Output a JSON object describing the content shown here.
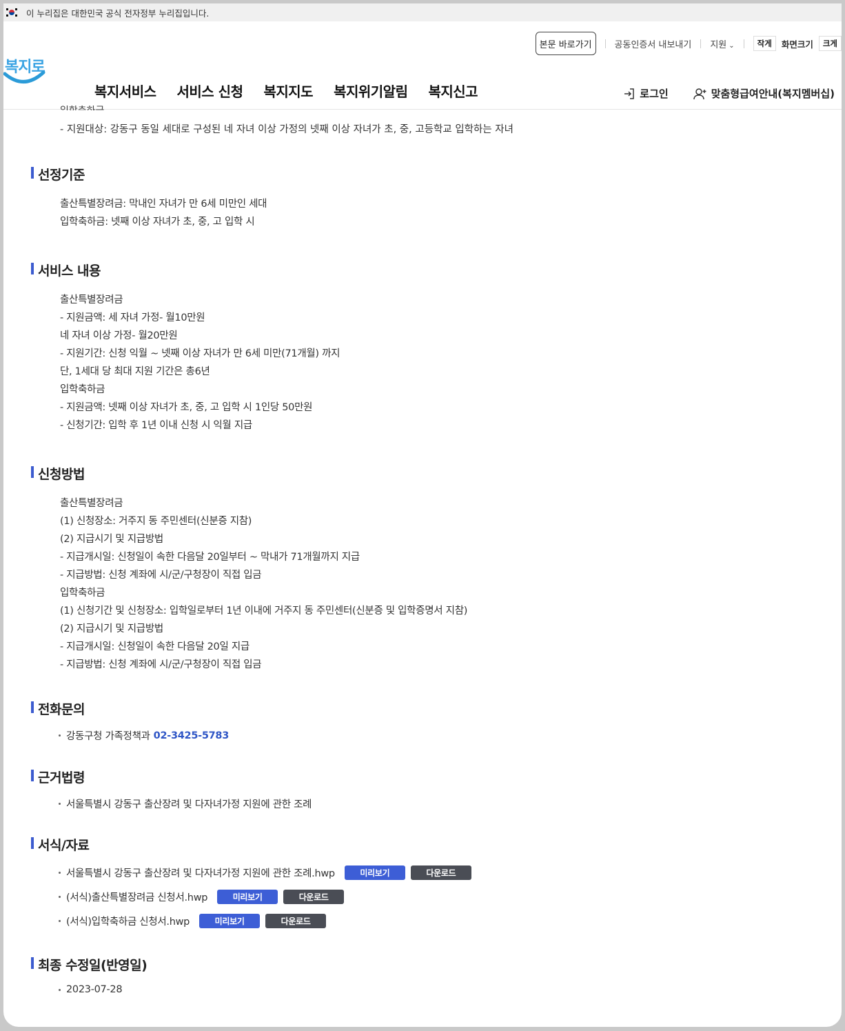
{
  "gov_banner": "이 누리집은 대한민국 공식 전자정부 누리집입니다.",
  "util": {
    "skip": "본문 바로가기",
    "cert": "공동인증서 내보내기",
    "support": "지원",
    "smaller": "작게",
    "zoom": "화면크기",
    "bigger": "크게"
  },
  "logo_text": "복지로",
  "nav": [
    "복지서비스",
    "서비스 신청",
    "복지지도",
    "복지위기알림",
    "복지신고"
  ],
  "header_right": {
    "login": "로그인",
    "membership": "맞춤형급여안내(복지멤버십)"
  },
  "intro": {
    "clipped": "입학축하금",
    "target": "- 지원대상: 강동구 동일 세대로 구성된 네 자녀 이상 가정의 넷째 이상 자녀가 초, 중, 고등학교 입학하는 자녀"
  },
  "sections": {
    "criteria": {
      "title": "선정기준",
      "lines": [
        "출산특별장려금: 막내인 자녀가 만 6세 미만인 세대",
        "입학축하금: 넷째 이상 자녀가 초, 중, 고 입학 시"
      ]
    },
    "content": {
      "title": "서비스 내용",
      "lines": [
        "출산특별장려금",
        "- 지원금액: 세 자녀 가정- 월10만원",
        "네 자녀 이상 가정- 월20만원",
        "- 지원기간: 신청 익월 ~ 넷째 이상 자녀가 만 6세 미만(71개월) 까지",
        "단, 1세대 당 최대 지원 기간은 총6년",
        "입학축하금",
        "- 지원금액: 넷째 이상 자녀가 초, 중, 고 입학 시 1인당 50만원",
        "- 신청기간: 입학 후 1년 이내 신청 시 익월 지급"
      ]
    },
    "method": {
      "title": "신청방법",
      "lines": [
        "출산특별장려금",
        "(1) 신청장소: 거주지 동 주민센터(신분증 지참)",
        "(2) 지급시기 및 지급방법",
        "- 지급개시일: 신청일이 속한 다음달 20일부터 ~ 막내가 71개월까지 지급",
        "- 지급방법: 신청 계좌에 시/군/구청장이 직접 입금",
        "입학축하금",
        "(1) 신청기간 및 신청장소: 입학일로부터 1년 이내에 거주지 동 주민센터(신분증 및 입학증명서 지참)",
        "(2) 지급시기 및 지급방법",
        "- 지급개시일: 신청일이 속한 다음달 20일 지급",
        "- 지급방법: 신청 계좌에 시/군/구청장이 직접 입금"
      ]
    },
    "phone": {
      "title": "전화문의",
      "org": "강동구청 가족정책과",
      "number": "02-3425-5783"
    },
    "law": {
      "title": "근거법령",
      "item": "서울특별시 강동구 출산장려 및 다자녀가정 지원에 관한 조례"
    },
    "forms": {
      "title": "서식/자료",
      "preview_label": "미리보기",
      "download_label": "다운로드",
      "files": [
        "서울특별시 강동구 출산장려 및 다자녀가정 지원에 관한 조례.hwp",
        "(서식)출산특별장려금 신청서.hwp",
        "(서식)입학축하금 신청서.hwp"
      ]
    },
    "updated": {
      "title": "최종 수정일(반영일)",
      "date": "2023-07-28"
    }
  }
}
